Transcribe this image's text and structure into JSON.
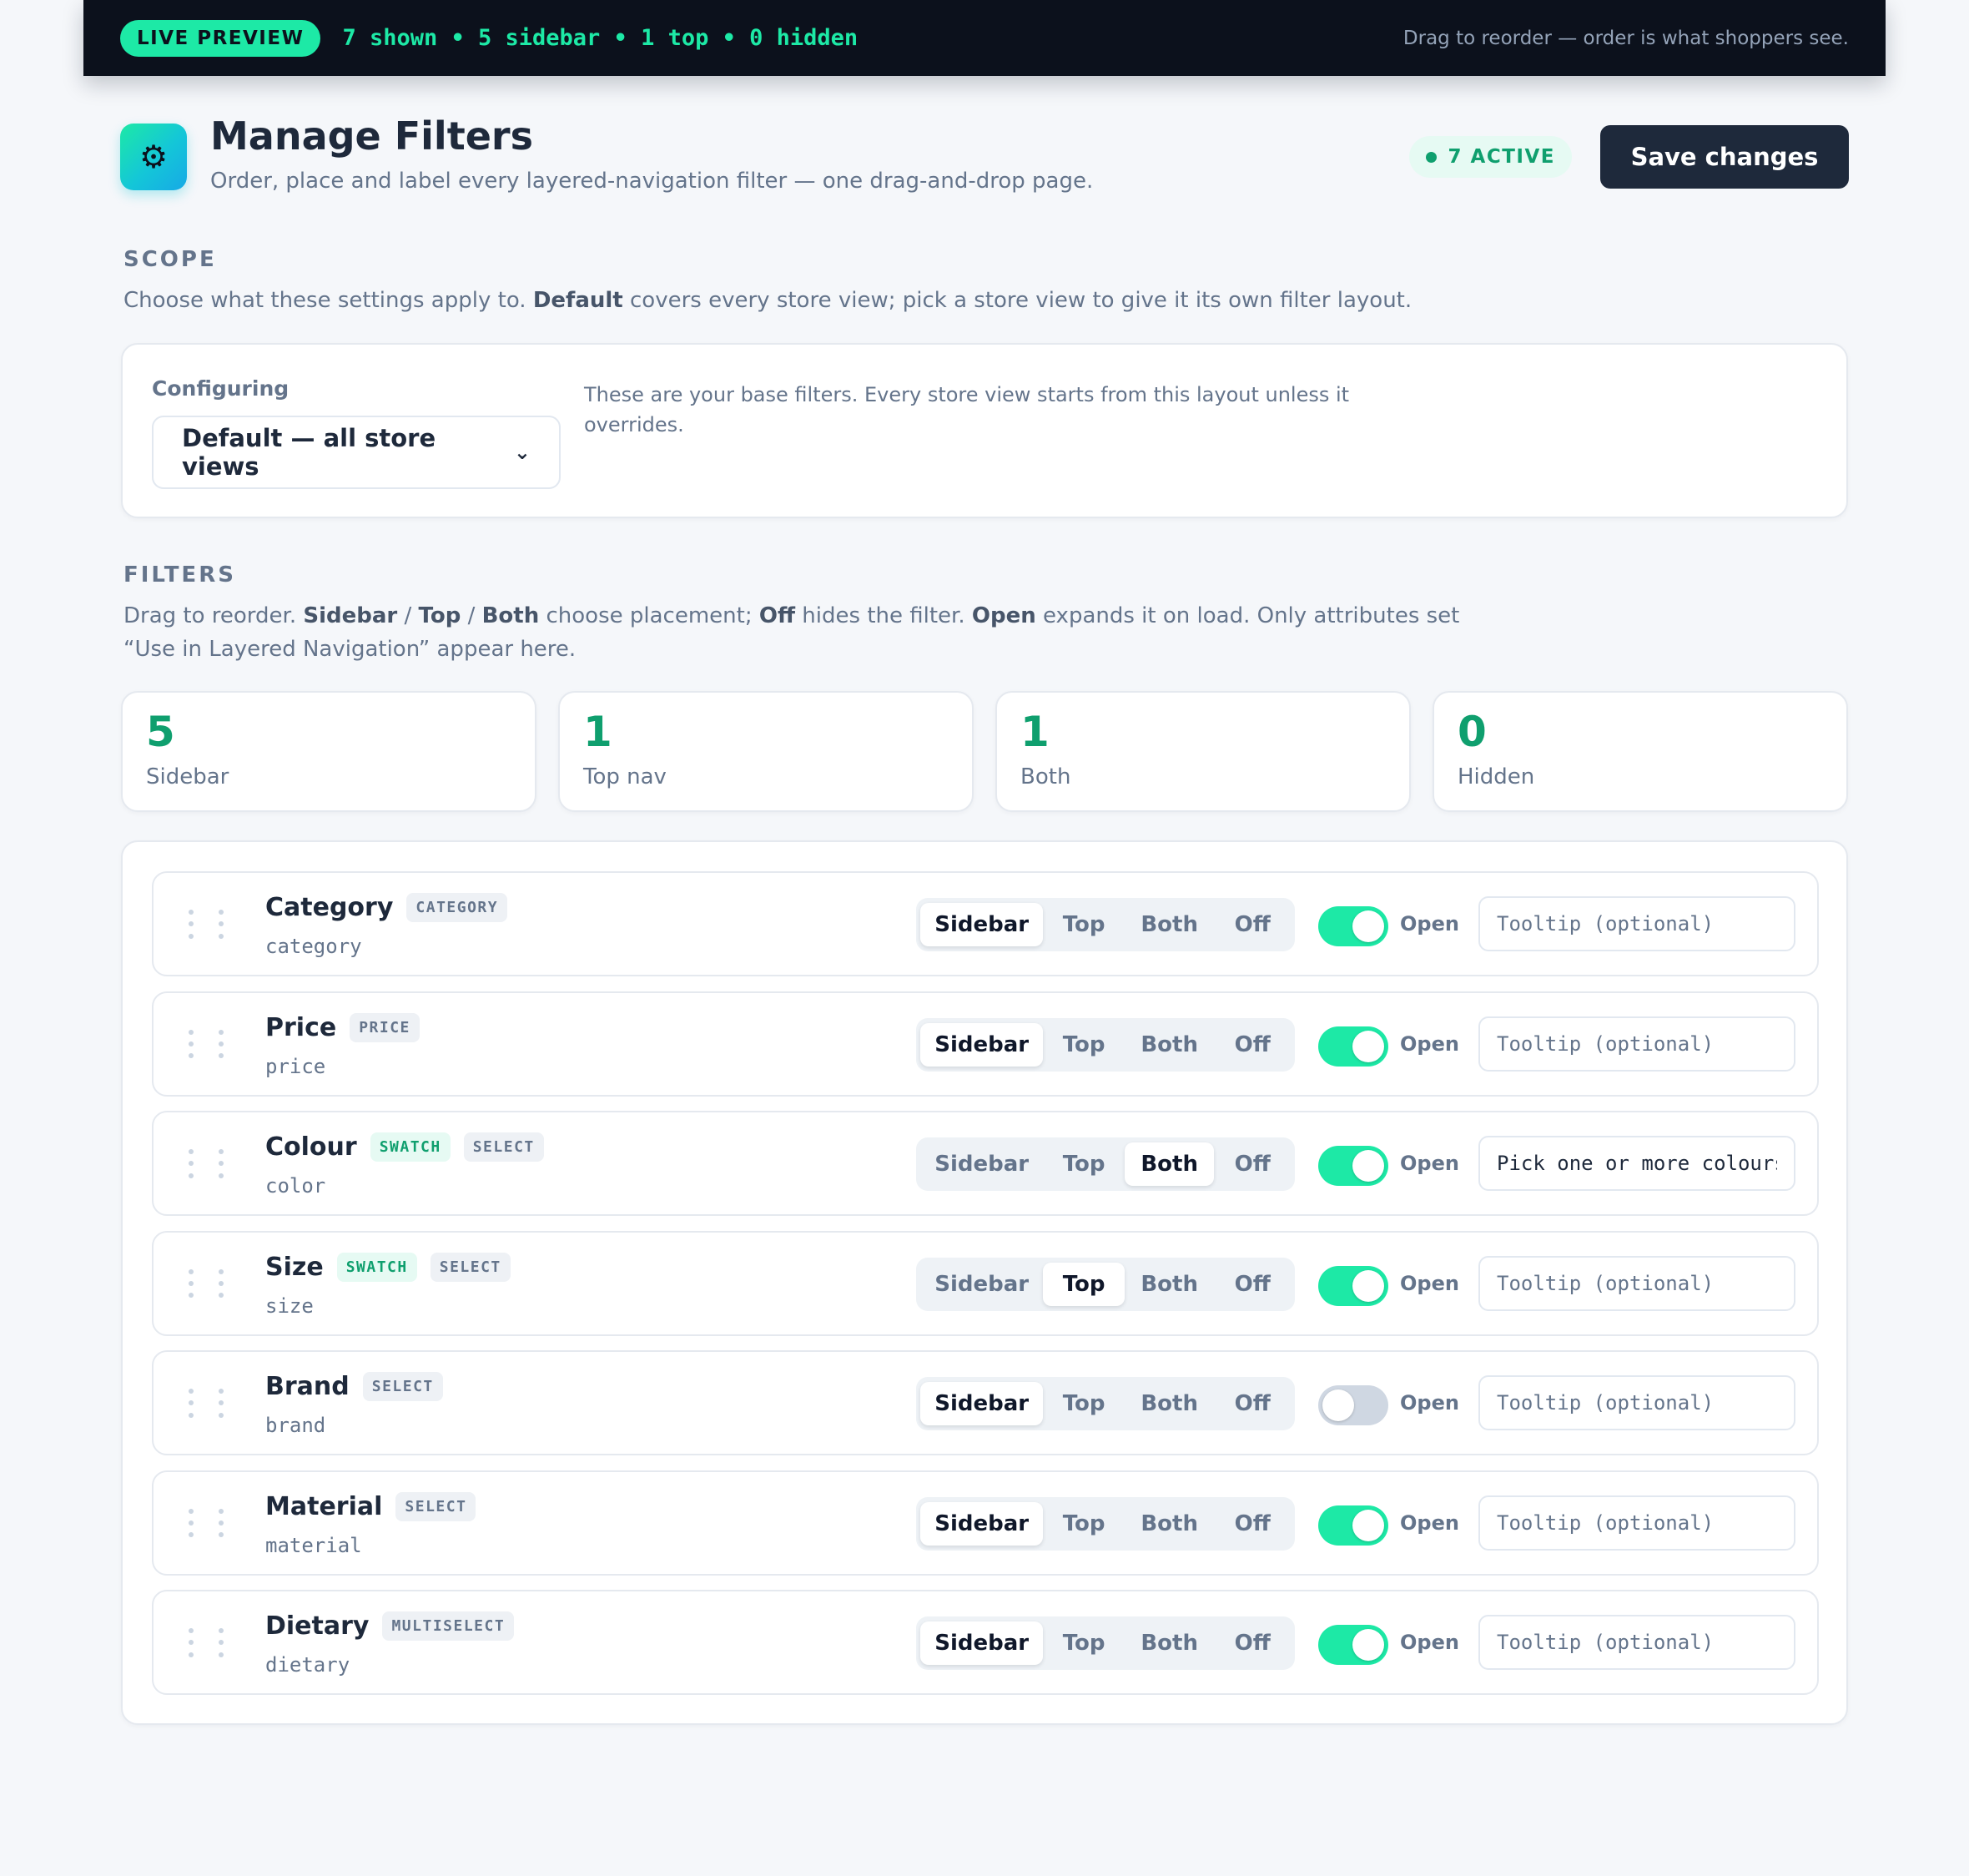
{
  "topbar": {
    "pill": "LIVE PREVIEW",
    "stats": "7 shown • 5 sidebar • 1 top • 0 hidden",
    "hint": "Drag to reorder — order is what shoppers see."
  },
  "header": {
    "icon": "gear-icon",
    "title": "Manage Filters",
    "subtitle": "Order, place and label every layered-navigation filter — one drag-and-drop page.",
    "active_badge": "7 ACTIVE",
    "save_label": "Save changes"
  },
  "scope": {
    "label": "SCOPE",
    "desc_1": "Choose what these settings apply to. ",
    "desc_bold": "Default",
    "desc_2": " covers every store view; pick a store view to give it its own filter layout.",
    "configuring_label": "Configuring",
    "selected": "Default — all store views",
    "note": "These are your base filters. Every store view starts from this layout unless it overrides."
  },
  "filters_section": {
    "label": "FILTERS",
    "desc_1": "Drag to reorder. ",
    "b_sidebar": "Sidebar",
    "sep_1": " / ",
    "b_top": "Top",
    "sep_2": " / ",
    "b_both": "Both",
    "desc_2": " choose placement; ",
    "b_off": "Off",
    "desc_3": " hides the filter. ",
    "b_open": "Open",
    "desc_4": " expands it on load. Only attributes set “Use in Layered Navigation” appear here."
  },
  "stats": [
    {
      "value": "5",
      "label": "Sidebar"
    },
    {
      "value": "1",
      "label": "Top nav"
    },
    {
      "value": "1",
      "label": "Both"
    },
    {
      "value": "0",
      "label": "Hidden"
    }
  ],
  "placement_options": [
    "Sidebar",
    "Top",
    "Both",
    "Off"
  ],
  "open_label": "Open",
  "tooltip_placeholder": "Tooltip (optional)",
  "filters": [
    {
      "name": "Category",
      "code": "category",
      "chips": [
        "CATEGORY"
      ],
      "placement": "Sidebar",
      "open": true,
      "tooltip": ""
    },
    {
      "name": "Price",
      "code": "price",
      "chips": [
        "PRICE"
      ],
      "placement": "Sidebar",
      "open": true,
      "tooltip": ""
    },
    {
      "name": "Colour",
      "code": "color",
      "chips": [
        "SWATCH",
        "SELECT"
      ],
      "placement": "Both",
      "open": true,
      "tooltip": "Pick one or more colours"
    },
    {
      "name": "Size",
      "code": "size",
      "chips": [
        "SWATCH",
        "SELECT"
      ],
      "placement": "Top",
      "open": true,
      "tooltip": ""
    },
    {
      "name": "Brand",
      "code": "brand",
      "chips": [
        "SELECT"
      ],
      "placement": "Sidebar",
      "open": false,
      "tooltip": ""
    },
    {
      "name": "Material",
      "code": "material",
      "chips": [
        "SELECT"
      ],
      "placement": "Sidebar",
      "open": true,
      "tooltip": ""
    },
    {
      "name": "Dietary",
      "code": "dietary",
      "chips": [
        "MULTISELECT"
      ],
      "placement": "Sidebar",
      "open": true,
      "tooltip": ""
    }
  ],
  "colors": {
    "accent": "#1de9a6",
    "accent_text": "#0f9f6e",
    "topbar_bg": "#0c111c",
    "primary_button": "#1e293b"
  }
}
